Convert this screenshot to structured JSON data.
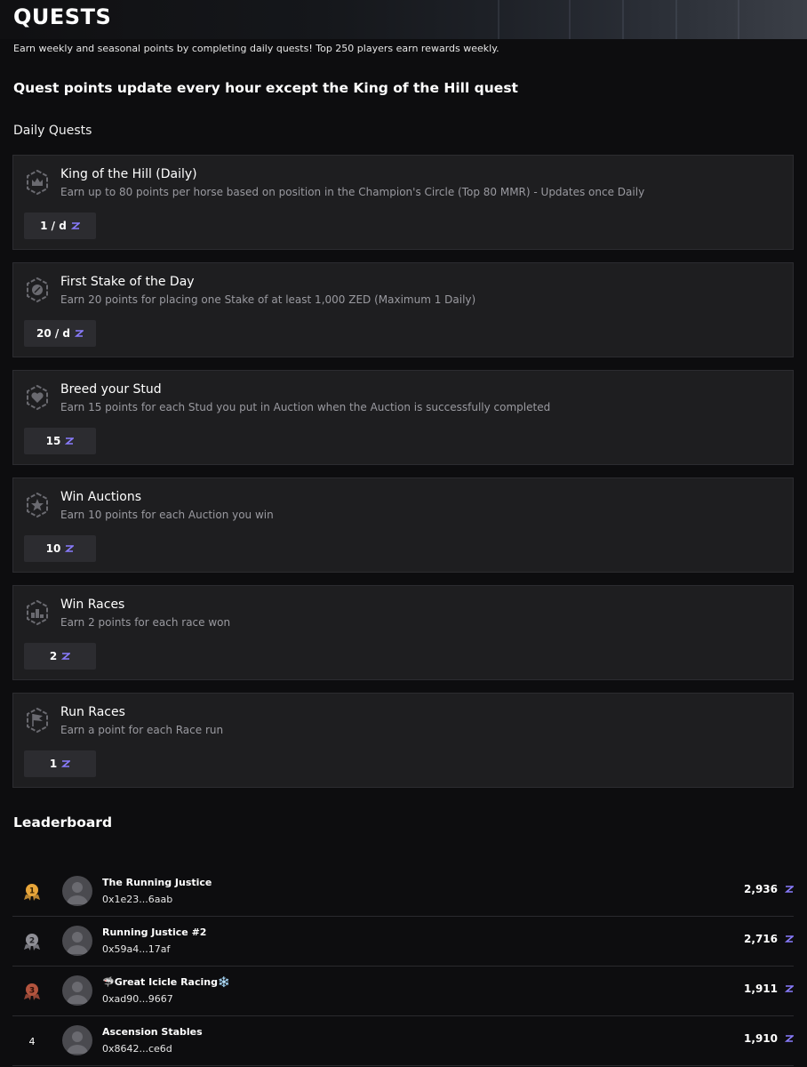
{
  "page": {
    "title": "QUESTS",
    "subtitle": "Earn weekly and seasonal points by completing daily quests! Top 250 players earn rewards weekly.",
    "notice": "Quest points update every hour except the King of the Hill quest",
    "daily_section_title": "Daily Quests",
    "leaderboard_title": "Leaderboard"
  },
  "colors": {
    "background": "#0d0d0f",
    "card": "#1e1e20",
    "badge": "#2c2c30",
    "zed_accent": "#8a7cff",
    "gold": "#e7a53a",
    "silver": "#8f8f96",
    "bronze": "#b3543e"
  },
  "quests": [
    {
      "icon": "crown-shield-icon",
      "title": "King of the Hill (Daily)",
      "description": "Earn up to 80 points per horse based on position in the Champion's Circle (Top 80 MMR) - Updates once Daily",
      "reward": "1 / d"
    },
    {
      "icon": "coin-shield-icon",
      "title": "First Stake of the Day",
      "description": "Earn 20 points for placing one Stake of at least 1,000 ZED (Maximum 1 Daily)",
      "reward": "20 / d"
    },
    {
      "icon": "heart-shield-icon",
      "title": "Breed your Stud",
      "description": "Earn 15 points for each Stud you put in Auction when the Auction is successfully completed",
      "reward": "15"
    },
    {
      "icon": "star-shield-icon",
      "title": "Win Auctions",
      "description": "Earn 10 points for each Auction you win",
      "reward": "10"
    },
    {
      "icon": "podium-shield-icon",
      "title": "Win Races",
      "description": "Earn 2 points for each race won",
      "reward": "2"
    },
    {
      "icon": "flag-shield-icon",
      "title": "Run Races",
      "description": "Earn a point for each Race run",
      "reward": "1"
    }
  ],
  "leaderboard": [
    {
      "rank": "1",
      "medal": "gold",
      "name": "The Running Justice",
      "address": "0x1e23...6aab",
      "points": "2,936"
    },
    {
      "rank": "2",
      "medal": "silver",
      "name": "Running Justice #2",
      "address": "0x59a4...17af",
      "points": "2,716"
    },
    {
      "rank": "3",
      "medal": "bronze",
      "name": "🦈Great Icicle Racing❄️",
      "address": "0xad90...9667",
      "points": "1,911"
    },
    {
      "rank": "4",
      "medal": "",
      "name": "Ascension Stables",
      "address": "0x8642...ce6d",
      "points": "1,910"
    }
  ]
}
